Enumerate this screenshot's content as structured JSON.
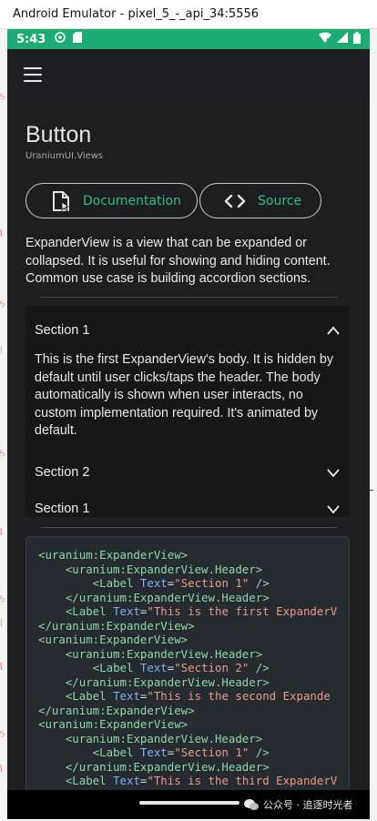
{
  "window": {
    "title": "Android Emulator - pixel_5_-_api_34:5556"
  },
  "statusbar": {
    "time": "5:43"
  },
  "appbar": {
    "menu_icon": "hamburger-icon"
  },
  "page": {
    "title": "Button",
    "subtitle": "UraniumUI.Views",
    "buttons": {
      "documentation": "Documentation",
      "source": "Source"
    },
    "description": "ExpanderView is a view that can be expanded or collapsed. It is useful for showing and hiding content. Common use case is building accordion sections."
  },
  "expander": {
    "sections": [
      {
        "title": "Section 1",
        "expanded": true,
        "body": "This is the first ExpanderView's body. It is hidden by default until user clicks/taps the header. The body automatically is shown when user interacts, no custom implementation required. It's animated by default."
      },
      {
        "title": "Section 2",
        "expanded": false
      },
      {
        "title": "Section 1",
        "expanded": false
      }
    ]
  },
  "code": {
    "lines": [
      "<uranium:ExpanderView>",
      "    <uranium:ExpanderView.Header>",
      "        <Label Text=\"Section 1\" />",
      "    </uranium:ExpanderView.Header>",
      "    <Label Text=\"This is the first ExpanderV",
      "</uranium:ExpanderView>",
      "<uranium:ExpanderView>",
      "    <uranium:ExpanderView.Header>",
      "        <Label Text=\"Section 2\" />",
      "    </uranium:ExpanderView.Header>",
      "    <Label Text=\"This is the second Expande",
      "</uranium:ExpanderView>",
      "<uranium:ExpanderView>",
      "    <uranium:ExpanderView.Header>",
      "        <Label Text=\"Section 1\" />",
      "    </uranium:ExpanderView.Header>",
      "    <Label Text=\"This is the third ExpanderV"
    ]
  },
  "watermark": {
    "text": "公众号 · 追逐时光者"
  },
  "colors": {
    "accent": "#2fbf80",
    "statusbar": "#1dab74",
    "background": "#1c1e22"
  }
}
